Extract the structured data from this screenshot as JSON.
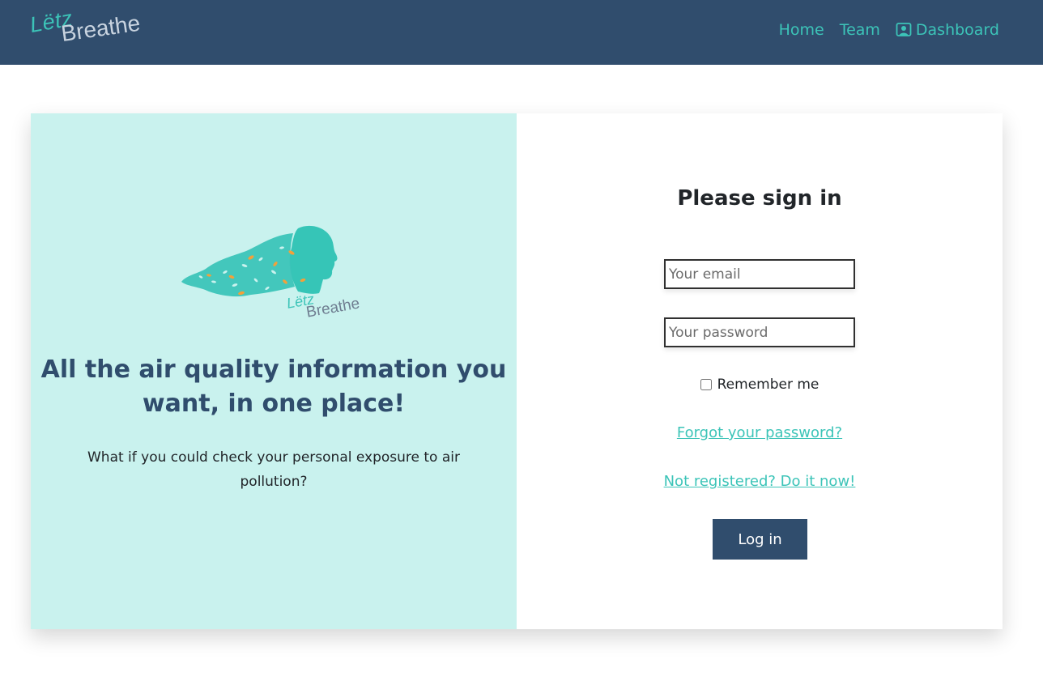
{
  "brand": {
    "line1": "Lëtz",
    "line2": "Breathe"
  },
  "nav": {
    "home": "Home",
    "team": "Team",
    "dashboard": "Dashboard",
    "dashboard_icon": "user-dashboard-icon"
  },
  "hero": {
    "logo_line1": "Lëtz",
    "logo_line2": "Breathe",
    "headline": "All the air quality information you want, in one place!",
    "subtext": "What if you could check your personal exposure to air pollution?"
  },
  "signin": {
    "title": "Please sign in",
    "email_placeholder": "Your email",
    "password_placeholder": "Your password",
    "remember_label": "Remember me",
    "forgot_link": "Forgot your password?",
    "register_link": "Not registered? Do it now!",
    "login_button": "Log in"
  },
  "colors": {
    "navbar": "#304d6d",
    "accent": "#3cc4b8",
    "hero_panel": "#c9f2ee",
    "headline": "#304d6d"
  }
}
